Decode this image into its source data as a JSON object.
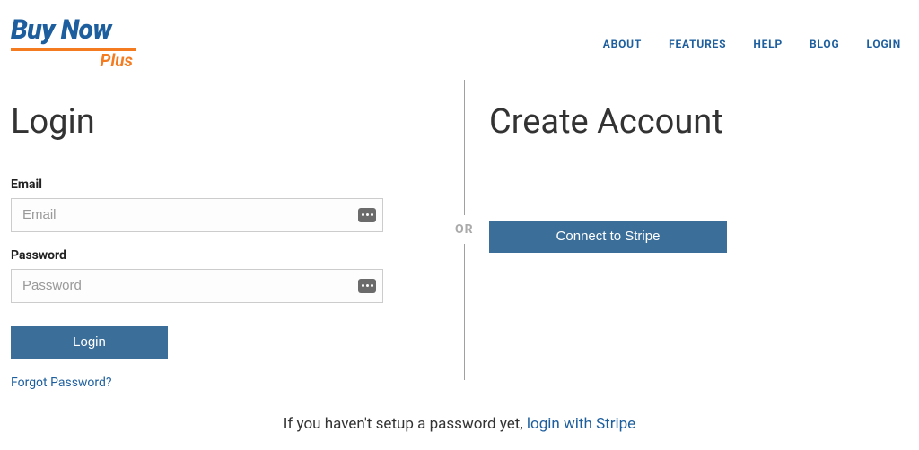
{
  "logo": {
    "word1": "Buy",
    "word2": "Now",
    "sub": "Plus"
  },
  "nav": {
    "about": "ABOUT",
    "features": "FEATURES",
    "help": "HELP",
    "blog": "BLOG",
    "login": "LOGIN"
  },
  "login": {
    "heading": "Login",
    "email_label": "Email",
    "email_placeholder": "Email",
    "password_label": "Password",
    "password_placeholder": "Password",
    "button": "Login",
    "forgot": "Forgot Password?"
  },
  "create": {
    "heading": "Create Account",
    "button": "Connect to Stripe"
  },
  "divider": {
    "or": "OR"
  },
  "footer": {
    "prefix": "If you haven't setup a password yet, ",
    "link": "login with Stripe"
  }
}
